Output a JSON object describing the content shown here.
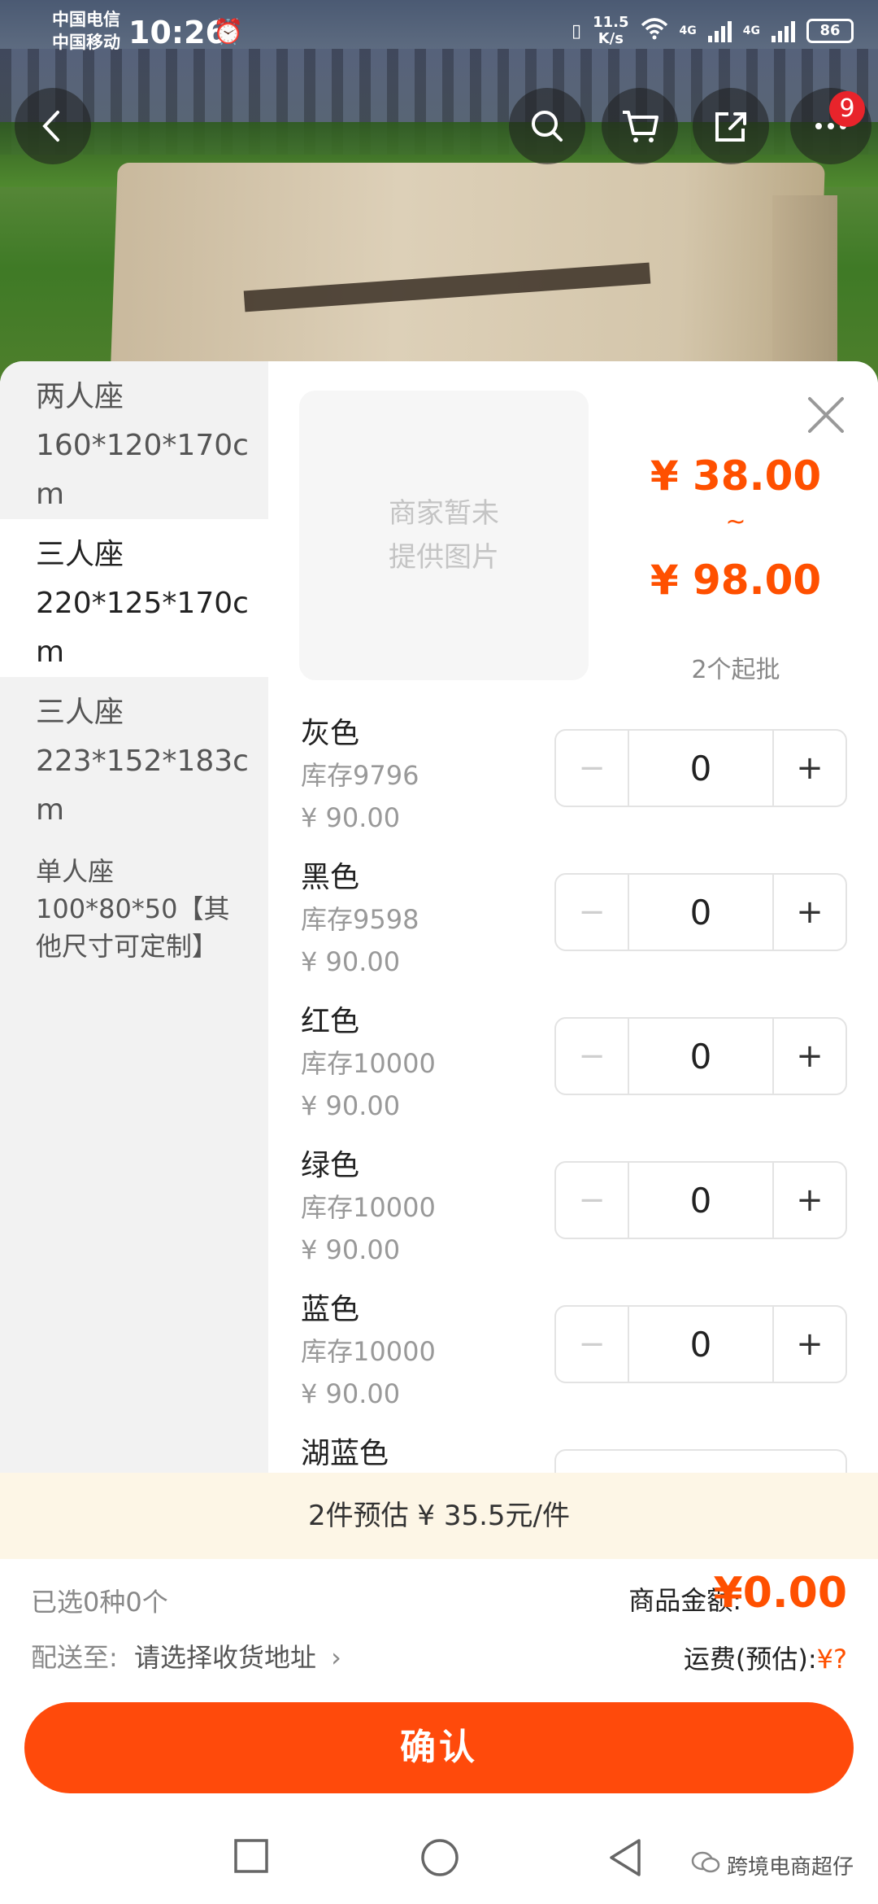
{
  "status_bar": {
    "carrier_1": "中国电信",
    "carrier_2": "中国移动",
    "time": "10:26",
    "net_speed_value": "11.5",
    "net_speed_unit": "K/s",
    "signal_1": "4G",
    "signal_2": "4G",
    "battery": "86"
  },
  "nav": {
    "more_badge": "9"
  },
  "sizes": [
    {
      "type": "两人座",
      "dims": "160*120*170cm"
    },
    {
      "type": "三人座",
      "dims": "220*125*170cm"
    },
    {
      "type": "三人座",
      "dims": "223*152*183cm"
    },
    {
      "type": "单人座",
      "dims": "100*80*50【其他尺寸可定制】"
    }
  ],
  "product": {
    "no_image_line1": "商家暂未",
    "no_image_line2": "提供图片",
    "price_low": "¥ 38.00",
    "tilde": "~",
    "price_high": "¥ 98.00",
    "min_batch": "2个起批"
  },
  "variants": [
    {
      "name": "灰色",
      "stock": "库存9796",
      "price": "¥ 90.00",
      "qty": "0"
    },
    {
      "name": "黑色",
      "stock": "库存9598",
      "price": "¥ 90.00",
      "qty": "0"
    },
    {
      "name": "红色",
      "stock": "库存10000",
      "price": "¥ 90.00",
      "qty": "0"
    },
    {
      "name": "绿色",
      "stock": "库存10000",
      "price": "¥ 90.00",
      "qty": "0"
    },
    {
      "name": "蓝色",
      "stock": "库存10000",
      "price": "¥ 90.00",
      "qty": "0"
    },
    {
      "name": "湖蓝色",
      "stock": "",
      "price": "",
      "qty": ""
    }
  ],
  "stepper": {
    "minus": "−",
    "plus": "+"
  },
  "estimate": "2件预估 ¥ 35.5元/件",
  "summary": {
    "selected": "已选0种0个",
    "ship_to_label": "配送至:",
    "ship_to_value": "请选择收货地址",
    "amount_label": "商品金额:",
    "amount": "¥0.00",
    "freight_label": "运费(预估):",
    "freight_value": "¥?"
  },
  "confirm": "确认",
  "watermark": "跨境电商超仔",
  "colors": {
    "accent": "#ff5000",
    "button": "#ff4a0b",
    "badge": "#e8242b"
  }
}
